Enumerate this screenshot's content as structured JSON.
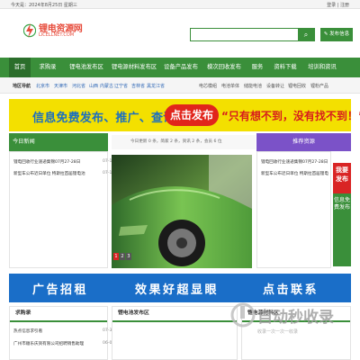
{
  "topbar": {
    "date": "今天是：2024年8月25日 星期三",
    "login": "登录",
    "register": "注册"
  },
  "logo": {
    "cn": "锂电资源网",
    "en": "LICELLNET.COM"
  },
  "search": {
    "placeholder": "",
    "button_icon": "search-icon",
    "publish": "发布信息"
  },
  "nav": [
    "首页",
    "求购录",
    "锂电池发布区",
    "锂电源材料发布区",
    "设备产品发布",
    "模次回收发布",
    "服务",
    "资料下载",
    "培训和资讯"
  ],
  "subnav": {
    "tag": "地区导航",
    "cities": [
      "北京市",
      "天津市",
      "河北省",
      "山西",
      "内蒙古",
      "辽宁省",
      "吉林省",
      "黑龙江省"
    ],
    "right": [
      "电芯模组",
      "电池单体",
      "储能电池",
      "设备转让",
      "锂电回收",
      "锂粉产品"
    ]
  },
  "banner_top": {
    "text1": "信息免费发布、推广、查询",
    "oval": "点击发布",
    "text2": "“只有想不到，没有找不到！”"
  },
  "news": {
    "title": "今日新闻",
    "items": [
      {
        "text": "锂电回收行业速递集锦07月27-28日",
        "date": "07-16"
      },
      {
        "text": "新型车公布近日单位 特斯拉首届锂电池",
        "date": "07-16"
      }
    ]
  },
  "stats": {
    "text": "今日更新 0 条，简家 2 条，资讯 2 条，会员 6 位"
  },
  "carousel": {
    "pages": [
      "1",
      "2",
      "3"
    ]
  },
  "recommend": {
    "title": "推荐资源",
    "items": [
      {
        "text": "锂电回收行业速递集锦07月27-28日",
        "date": "07-16"
      },
      {
        "text": "新型车公布近日单位 特斯拉首届锂电",
        "date": "07-16"
      }
    ]
  },
  "side_float": {
    "top": "我要发布",
    "text": "信息免费发布"
  },
  "banner_bottom": {
    "text1": "广告招租",
    "text2": "效果好超显眼",
    "text3": "点击联系"
  },
  "sections": [
    {
      "title": "求购录",
      "items": [
        {
          "text": "热点信息求引看",
          "date": "07-31"
        },
        {
          "text": "广州市顺乐庆资有限公司招聘销售助理",
          "date": "06-02"
        }
      ]
    },
    {
      "title": "锂电池发布区",
      "items": []
    },
    {
      "title": "锂电源材料区",
      "items": []
    }
  ],
  "watermark": {
    "text": "自动秒收录",
    "sub": "收录一次一次一收录"
  },
  "colors": {
    "brand_green": "#3a8f3a",
    "banner_yellow": "#f3e000",
    "banner_blue": "#1a6ec8",
    "accent_red": "#e1251b",
    "header_purple": "#7b52c8"
  }
}
